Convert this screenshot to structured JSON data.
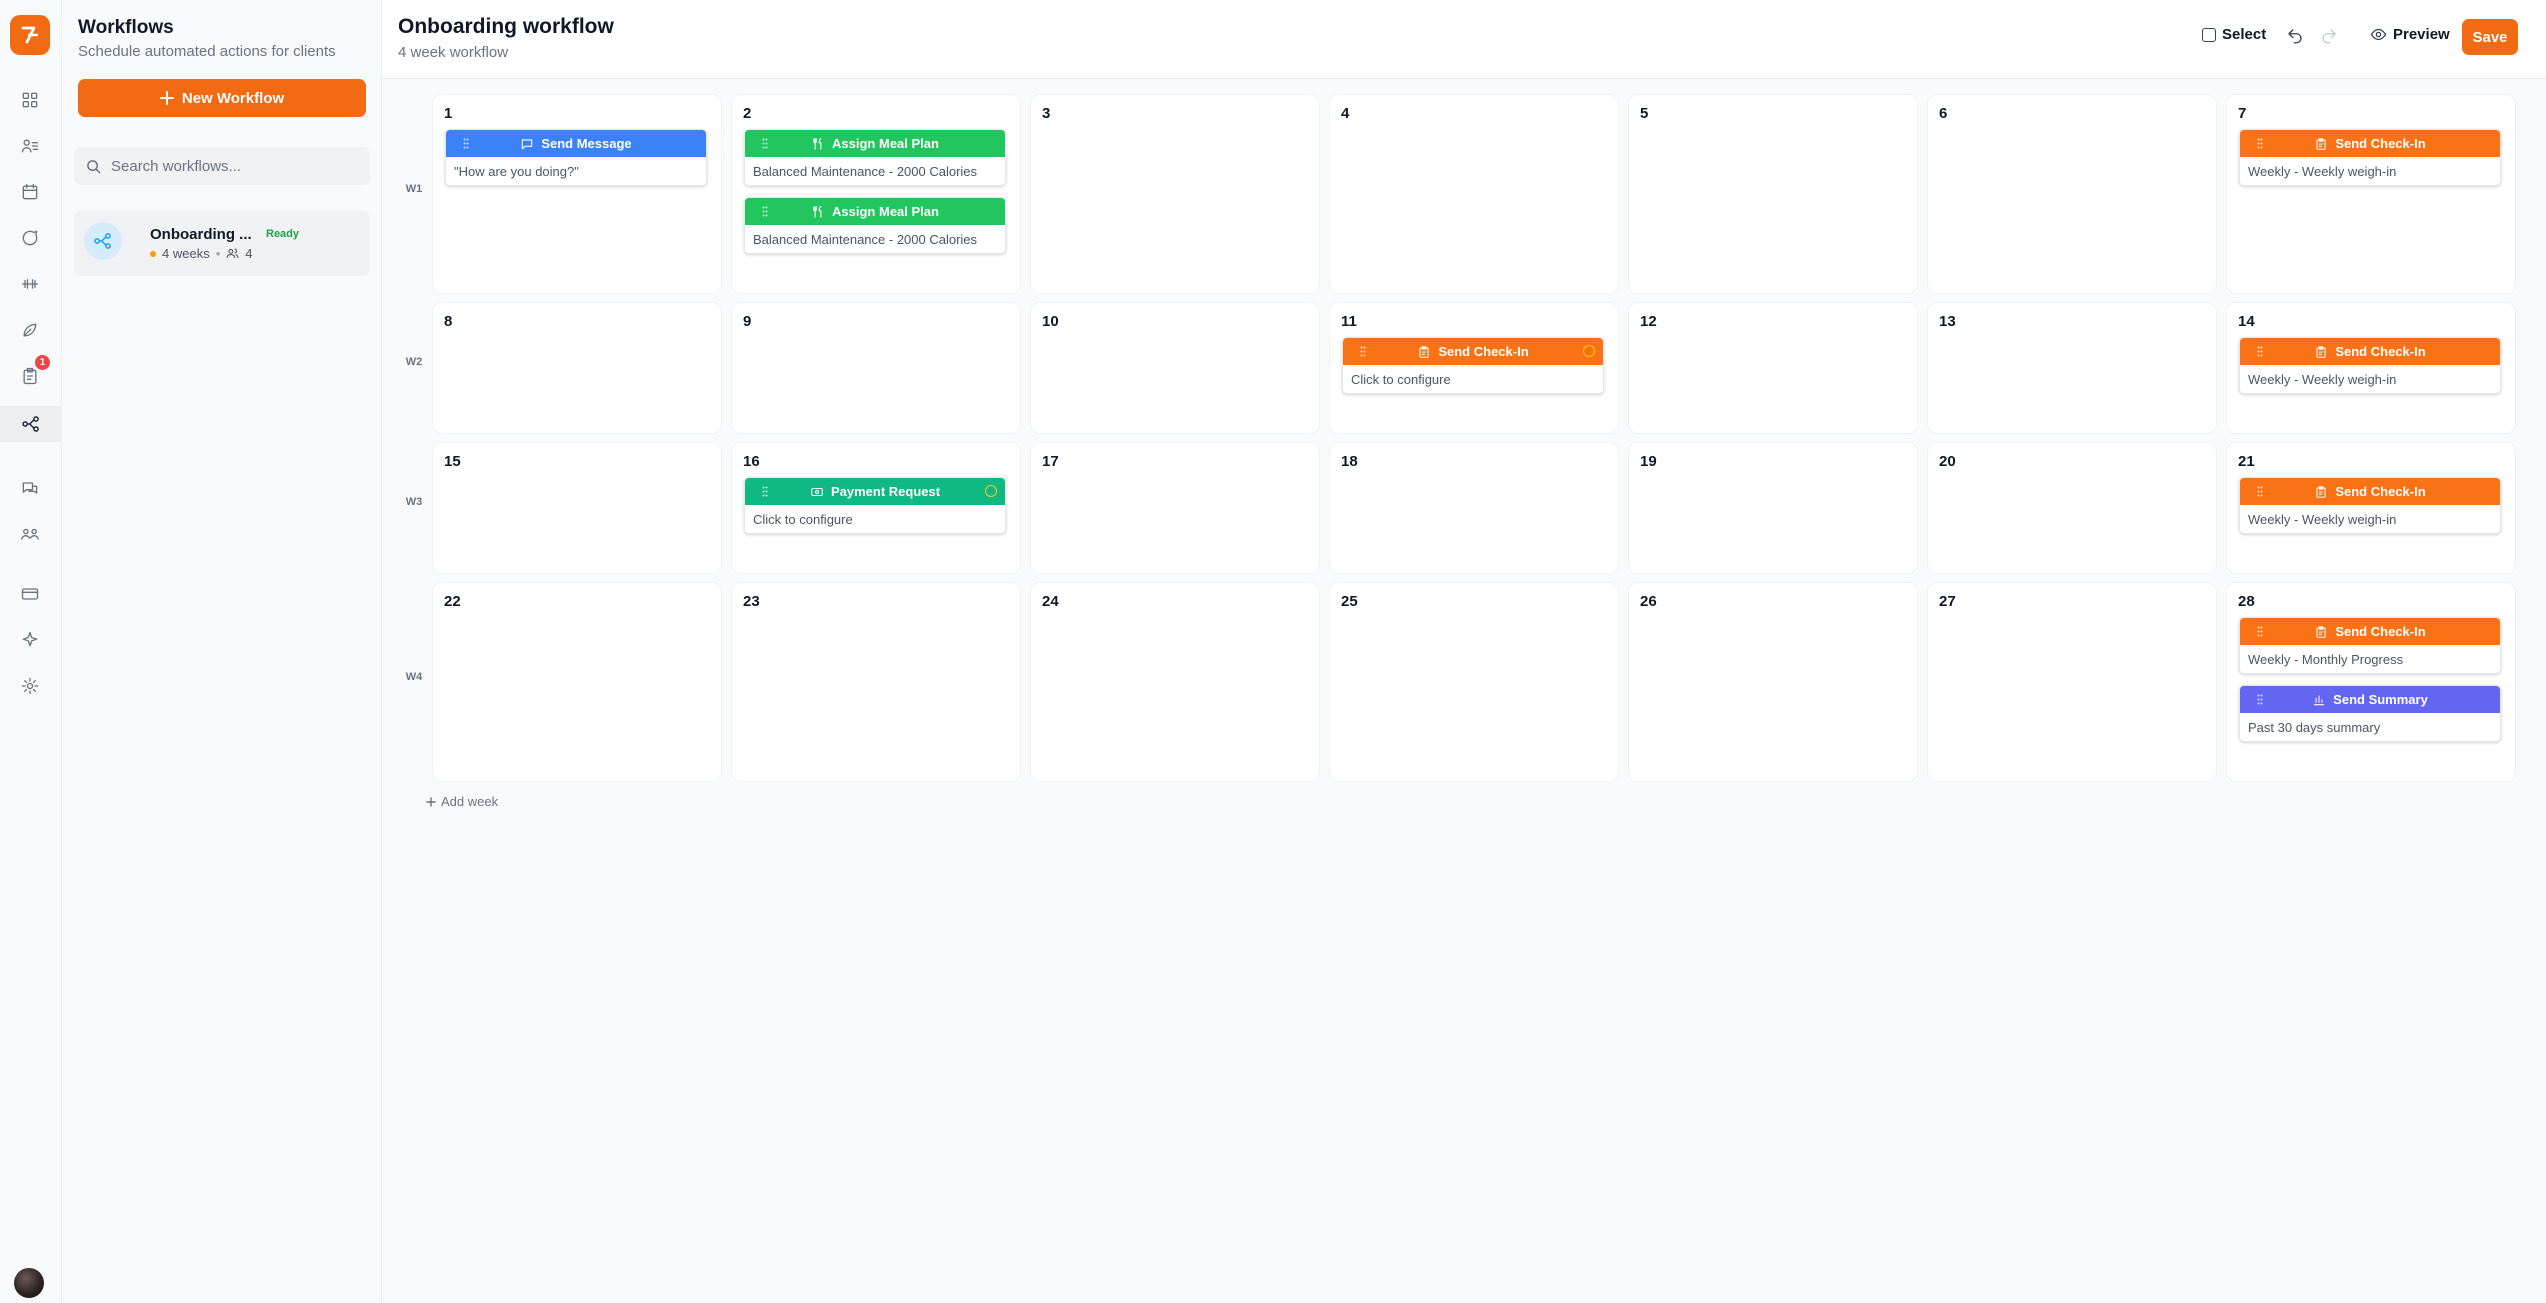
{
  "rail": {
    "badge_count": "1",
    "icons": [
      "dashboard-icon",
      "clients-icon",
      "calendar-icon",
      "messages-icon",
      "workouts-icon",
      "nutrition-icon",
      "checkins-icon",
      "workflows-icon",
      "chat-icon",
      "community-icon",
      "payments-icon",
      "ai-icon",
      "settings-icon"
    ]
  },
  "panel": {
    "title": "Workflows",
    "subtitle": "Schedule automated actions for clients",
    "new_button": "New Workflow",
    "search_placeholder": "Search workflows...",
    "items": [
      {
        "name": "Onboarding ...",
        "status": "Ready",
        "weeks": "4 weeks",
        "clients": "4"
      }
    ]
  },
  "header": {
    "title": "Onboarding workflow",
    "subtitle": "4 week workflow",
    "select_label": "Select",
    "preview_label": "Preview",
    "save_label": "Save"
  },
  "colors": {
    "accent": "#f26a12",
    "message": "#3b82f6",
    "meal": "#22c55e",
    "payment": "#10b981",
    "checkin": "#f97316",
    "summary": "#6366f1"
  },
  "weeks": [
    {
      "label": "W1",
      "days": [
        {
          "num": "1",
          "actions": [
            {
              "type": "message",
              "title": "Send Message",
              "detail": "\"How are you doing?\""
            }
          ]
        },
        {
          "num": "2",
          "actions": [
            {
              "type": "meal",
              "title": "Assign Meal Plan",
              "detail": "Balanced Maintenance - 2000 Calories"
            },
            {
              "type": "meal",
              "title": "Assign Meal Plan",
              "detail": "Balanced Maintenance - 2000 Calories"
            }
          ]
        },
        {
          "num": "3",
          "actions": []
        },
        {
          "num": "4",
          "actions": []
        },
        {
          "num": "5",
          "actions": []
        },
        {
          "num": "6",
          "actions": []
        },
        {
          "num": "7",
          "actions": [
            {
              "type": "checkin",
              "title": "Send Check-In",
              "detail": "Weekly - Weekly weigh-in"
            }
          ]
        }
      ]
    },
    {
      "label": "W2",
      "days": [
        {
          "num": "8",
          "actions": []
        },
        {
          "num": "9",
          "actions": []
        },
        {
          "num": "10",
          "actions": []
        },
        {
          "num": "11",
          "actions": [
            {
              "type": "checkin",
              "title": "Send Check-In",
              "detail": "Click to configure",
              "warning": true
            }
          ]
        },
        {
          "num": "12",
          "actions": []
        },
        {
          "num": "13",
          "actions": []
        },
        {
          "num": "14",
          "actions": [
            {
              "type": "checkin",
              "title": "Send Check-In",
              "detail": "Weekly - Weekly weigh-in"
            }
          ]
        }
      ]
    },
    {
      "label": "W3",
      "days": [
        {
          "num": "15",
          "actions": []
        },
        {
          "num": "16",
          "actions": [
            {
              "type": "payment",
              "title": "Payment Request",
              "detail": "Click to configure",
              "warning": true
            }
          ]
        },
        {
          "num": "17",
          "actions": []
        },
        {
          "num": "18",
          "actions": []
        },
        {
          "num": "19",
          "actions": []
        },
        {
          "num": "20",
          "actions": []
        },
        {
          "num": "21",
          "actions": [
            {
              "type": "checkin",
              "title": "Send Check-In",
              "detail": "Weekly - Weekly weigh-in"
            }
          ]
        }
      ]
    },
    {
      "label": "W4",
      "days": [
        {
          "num": "22",
          "actions": []
        },
        {
          "num": "23",
          "actions": []
        },
        {
          "num": "24",
          "actions": []
        },
        {
          "num": "25",
          "actions": []
        },
        {
          "num": "26",
          "actions": []
        },
        {
          "num": "27",
          "actions": []
        },
        {
          "num": "28",
          "actions": [
            {
              "type": "checkin",
              "title": "Send Check-In",
              "detail": "Weekly - Monthly Progress"
            },
            {
              "type": "summary",
              "title": "Send Summary",
              "detail": "Past 30 days summary"
            }
          ]
        }
      ]
    }
  ],
  "add_week_label": "Add week"
}
